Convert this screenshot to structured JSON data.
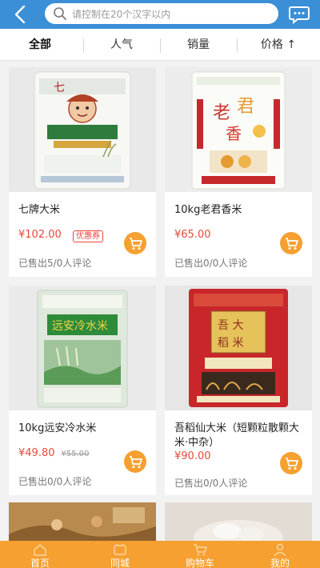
{
  "header": {
    "search_placeholder": "请控制在20个汉字以内",
    "accent_color": "#3b8fd6"
  },
  "sort_tabs": [
    {
      "label": "全部",
      "active": true
    },
    {
      "label": "人气",
      "active": false
    },
    {
      "label": "销量",
      "active": false
    },
    {
      "label": "价格 ↑",
      "active": false
    }
  ],
  "products": [
    {
      "title": "七牌大米",
      "price": "¥102.00",
      "old_price": "",
      "badge": "优惠券",
      "sold": "已售出5/0人评论"
    },
    {
      "title": "10kg老君香米",
      "price": "¥65.00",
      "old_price": "",
      "badge": "",
      "sold": "已售出0/0人评论"
    },
    {
      "title": "10kg远安冷水米",
      "price": "¥49.80",
      "old_price": "¥55.00",
      "badge": "",
      "sold": "已售出0/0人评论"
    },
    {
      "title": "吾稻仙大米（短颗粒散颗大米·中杂）",
      "price": "¥90.00",
      "old_price": "",
      "badge": "",
      "sold": "已售出0/0人评论"
    }
  ],
  "bottom_nav": [
    {
      "label": "首页",
      "icon": "home-icon"
    },
    {
      "label": "同城",
      "icon": "nearby-icon"
    },
    {
      "label": "购物车",
      "icon": "cart-icon"
    },
    {
      "label": "我的",
      "icon": "user-icon"
    }
  ],
  "colors": {
    "price": "#e8483a",
    "cart_button": "#f5a030",
    "bottom_nav": "#f5a030"
  }
}
